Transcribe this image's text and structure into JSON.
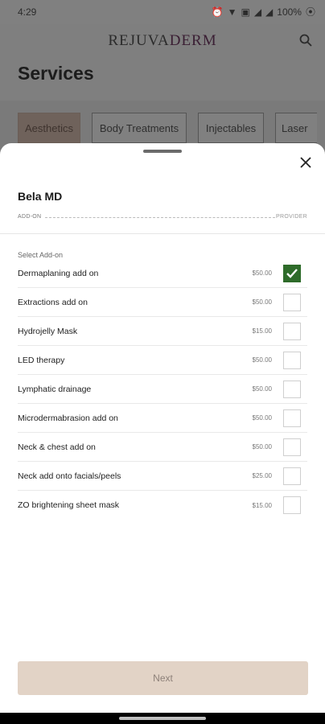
{
  "status_bar": {
    "time": "4:29",
    "battery": "100%"
  },
  "header": {
    "brand_part1": "REJUVA",
    "brand_part2": "DERM",
    "page_title": "Services"
  },
  "tabs": [
    {
      "label": "Aesthetics",
      "active": true
    },
    {
      "label": "Body Treatments",
      "active": false
    },
    {
      "label": "Injectables",
      "active": false
    },
    {
      "label": "Laser",
      "active": false
    }
  ],
  "sheet": {
    "provider": "Bela MD",
    "step_left": "ADD-ON",
    "step_right": "PROVIDER",
    "section_label": "Select Add-on",
    "addons": [
      {
        "name": "Dermaplaning add on",
        "price": "$50.00",
        "checked": true
      },
      {
        "name": "Extractions add on",
        "price": "$50.00",
        "checked": false
      },
      {
        "name": "Hydrojelly Mask",
        "price": "$15.00",
        "checked": false
      },
      {
        "name": "LED therapy",
        "price": "$50.00",
        "checked": false
      },
      {
        "name": "Lymphatic drainage",
        "price": "$50.00",
        "checked": false
      },
      {
        "name": "Microdermabrasion add on",
        "price": "$50.00",
        "checked": false
      },
      {
        "name": "Neck & chest add on",
        "price": "$50.00",
        "checked": false
      },
      {
        "name": "Neck add onto facials/peels",
        "price": "$25.00",
        "checked": false
      },
      {
        "name": "ZO brightening sheet mask",
        "price": "$15.00",
        "checked": false
      }
    ],
    "next_label": "Next"
  },
  "colors": {
    "checked": "#2e6b2a",
    "next_button": "#e2d3c6",
    "active_tab": "#6f625b"
  }
}
